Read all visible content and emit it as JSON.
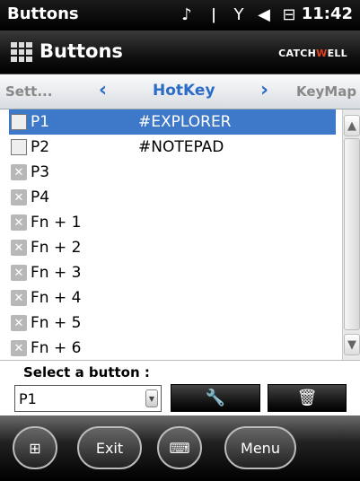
{
  "statusbar": {
    "title": "Buttons",
    "time": "11:42"
  },
  "titlebar": {
    "title": "Buttons",
    "brand_prefix": "CATCH",
    "brand_w": "W",
    "brand_suffix": "ELL"
  },
  "tabs": {
    "prev": "Sett...",
    "current": "HotKey",
    "next": "KeyMap"
  },
  "list": [
    {
      "name": "P1",
      "value": "#EXPLORER",
      "icon": "pc",
      "selected": true
    },
    {
      "name": "P2",
      "value": "#NOTEPAD",
      "icon": "pc",
      "selected": false
    },
    {
      "name": "P3",
      "value": "",
      "icon": "x",
      "selected": false
    },
    {
      "name": "P4",
      "value": "",
      "icon": "x",
      "selected": false
    },
    {
      "name": "Fn + 1",
      "value": "",
      "icon": "x",
      "selected": false
    },
    {
      "name": "Fn + 2",
      "value": "",
      "icon": "x",
      "selected": false
    },
    {
      "name": "Fn + 3",
      "value": "",
      "icon": "x",
      "selected": false
    },
    {
      "name": "Fn + 4",
      "value": "",
      "icon": "x",
      "selected": false
    },
    {
      "name": "Fn + 5",
      "value": "",
      "icon": "x",
      "selected": false
    },
    {
      "name": "Fn + 6",
      "value": "",
      "icon": "x",
      "selected": false
    }
  ],
  "panel": {
    "label": "Select a button :",
    "selected_value": "P1"
  },
  "softkeys": {
    "left": "Exit",
    "right": "Menu"
  },
  "colors": {
    "accent": "#2a6cc8",
    "selection": "#3e78c8"
  }
}
